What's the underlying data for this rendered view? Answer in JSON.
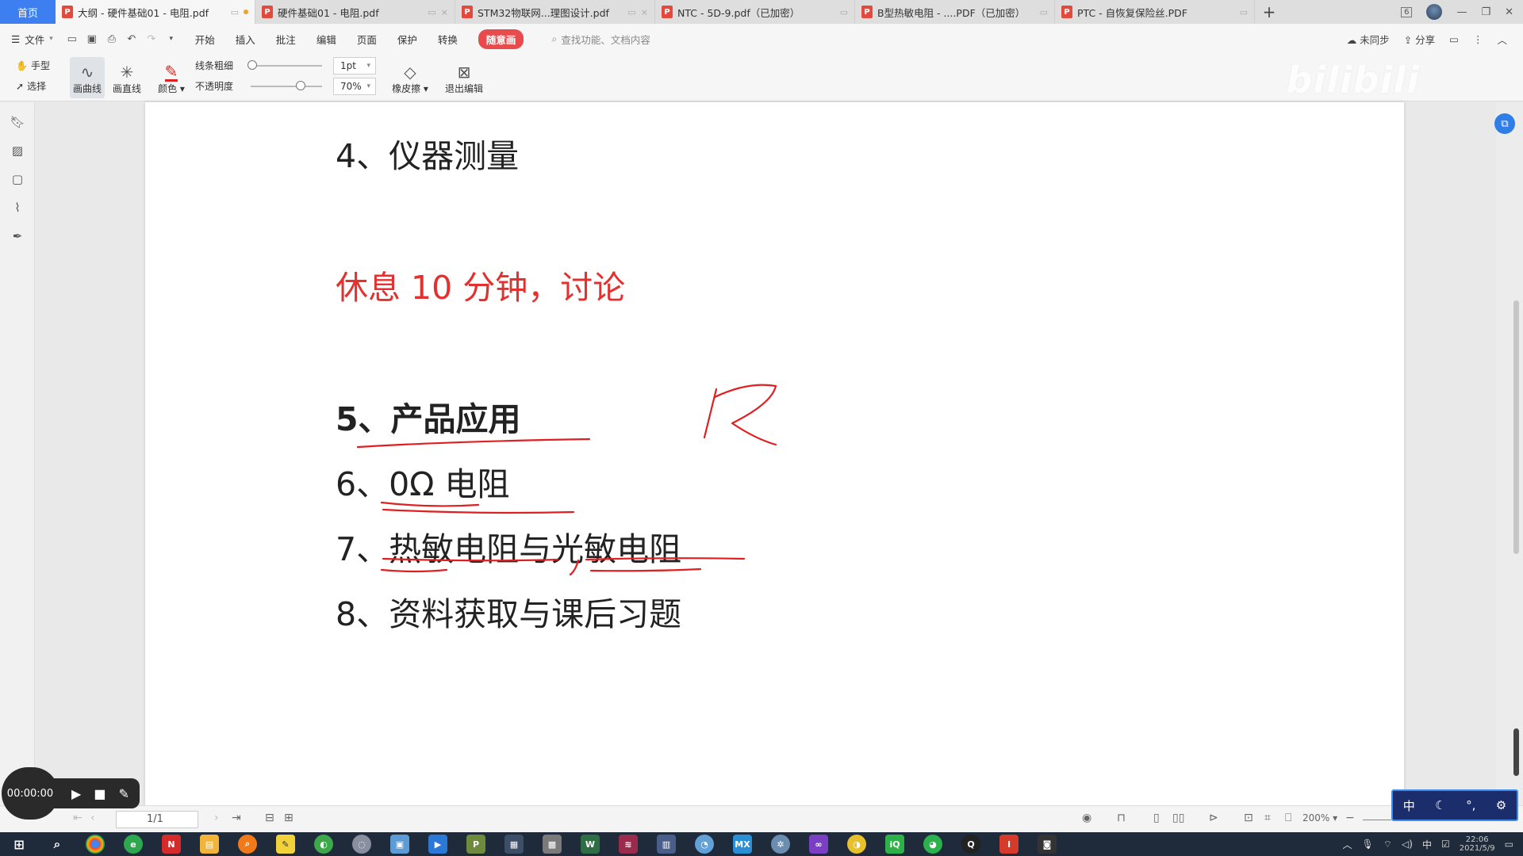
{
  "tabs": {
    "home": "首页",
    "items": [
      {
        "title": "大纲 - 硬件基础01 - 电阻.pdf",
        "active": true
      },
      {
        "title": "硬件基础01 - 电阻.pdf",
        "active": false
      },
      {
        "title": "STM32物联网...理图设计.pdf",
        "active": false
      },
      {
        "title": "NTC - 5D-9.pdf（已加密）",
        "active": false
      },
      {
        "title": "B型热敏电阻 - ....PDF（已加密）",
        "active": false
      },
      {
        "title": "PTC - 自恢复保险丝.PDF",
        "active": false
      }
    ],
    "add": "+",
    "badge": "6"
  },
  "menu": {
    "file": "文件",
    "items": [
      "开始",
      "插入",
      "批注",
      "编辑",
      "页面",
      "保护",
      "转换"
    ],
    "highlight": "随意画",
    "search_placeholder": "查找功能、文档内容",
    "sync": "未同步",
    "share": "分享"
  },
  "toolbar": {
    "hand": "手型",
    "select": "选择",
    "curve": "画曲线",
    "straight": "画直线",
    "color": "颜色",
    "thickness_label": "线条粗细",
    "thickness_value": "1pt",
    "opacity_label": "不透明度",
    "opacity_value": "70%",
    "opacity_fraction": 0.7,
    "eraser": "橡皮擦",
    "exit": "退出编辑",
    "ink_color": "#e02020",
    "watermark": "bilibili"
  },
  "document": {
    "lines": [
      {
        "text": "4、仪器测量",
        "style": "normal"
      },
      {
        "text": "休息 10 分钟，讨论",
        "style": "red"
      },
      {
        "text": "5、产品应用",
        "style": "bold"
      },
      {
        "text": "6、0Ω 电阻",
        "style": "normal"
      },
      {
        "text": "7、热敏电阻与光敏电阻",
        "style": "normal"
      },
      {
        "text": "8、资料获取与课后习题",
        "style": "normal"
      }
    ],
    "annotation_letter": "R"
  },
  "status": {
    "page": "1/1",
    "zoom": "200%"
  },
  "recorder": {
    "time": "00:00:00"
  },
  "ime": {
    "mode": "中"
  },
  "taskbar": {
    "tray_lang": "中",
    "time": "22:06",
    "date": "2021/5/9"
  },
  "colors": {
    "accent": "#3d7ff0",
    "highlight_menu": "#e84b4b",
    "red_text": "#e53030"
  }
}
